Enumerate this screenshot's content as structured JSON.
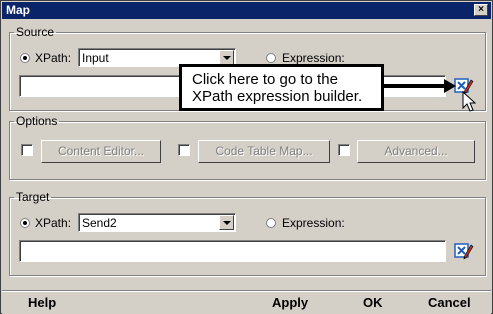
{
  "window": {
    "title": "Map",
    "close_label": "×"
  },
  "source": {
    "legend": "Source",
    "xpath_label": "XPath:",
    "xpath_value": "Input",
    "xpath_selected": true,
    "expression_label": "Expression:",
    "expression_value": ""
  },
  "callout": {
    "line1": "Click here to go to the",
    "line2": "XPath expression builder."
  },
  "options": {
    "legend": "Options",
    "content_editor_label": "Content Editor...",
    "code_table_map_label": "Code Table Map...",
    "advanced_label": "Advanced..."
  },
  "target": {
    "legend": "Target",
    "xpath_label": "XPath:",
    "xpath_value": "Send2",
    "xpath_selected": true,
    "expression_label": "Expression:",
    "expression_value": ""
  },
  "footer": {
    "help_label": "Help",
    "apply_label": "Apply",
    "ok_label": "OK",
    "cancel_label": "Cancel"
  },
  "colors": {
    "title_bar": "#0a246a",
    "dialog_face": "#d4d0c8",
    "builder_icon_accent": "#1f5fbf",
    "builder_icon_pencil": "#c03020"
  },
  "icons": {
    "builder": "xpath-builder-icon",
    "cursor": "mouse-pointer-icon",
    "close": "close-icon",
    "dropdown": "chevron-down-icon"
  }
}
